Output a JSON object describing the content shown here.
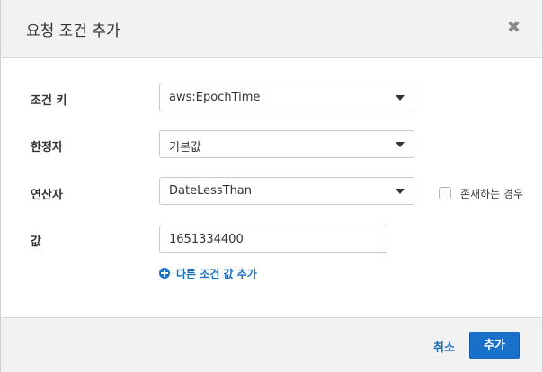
{
  "dialog": {
    "title": "요청 조건 추가",
    "close_glyph": "✖"
  },
  "form": {
    "condition_key": {
      "label": "조건 키",
      "value": "aws:EpochTime"
    },
    "qualifier": {
      "label": "한정자",
      "value": "기본값"
    },
    "operator": {
      "label": "연산자",
      "value": "DateLessThan"
    },
    "if_exists": {
      "label": "존재하는 경우",
      "checked": false
    },
    "value": {
      "label": "값",
      "value": "1651334400"
    },
    "add_another_value": "다른 조건 값 추가"
  },
  "footer": {
    "cancel_label": "취소",
    "add_label": "추가"
  },
  "colors": {
    "primary": "#1a6fc8",
    "link": "#1a6fc0",
    "header_bg": "#f2f2f2"
  },
  "icons": {
    "close": "close-icon",
    "dropdown": "chevron-down-icon",
    "add": "plus-circle-icon"
  }
}
